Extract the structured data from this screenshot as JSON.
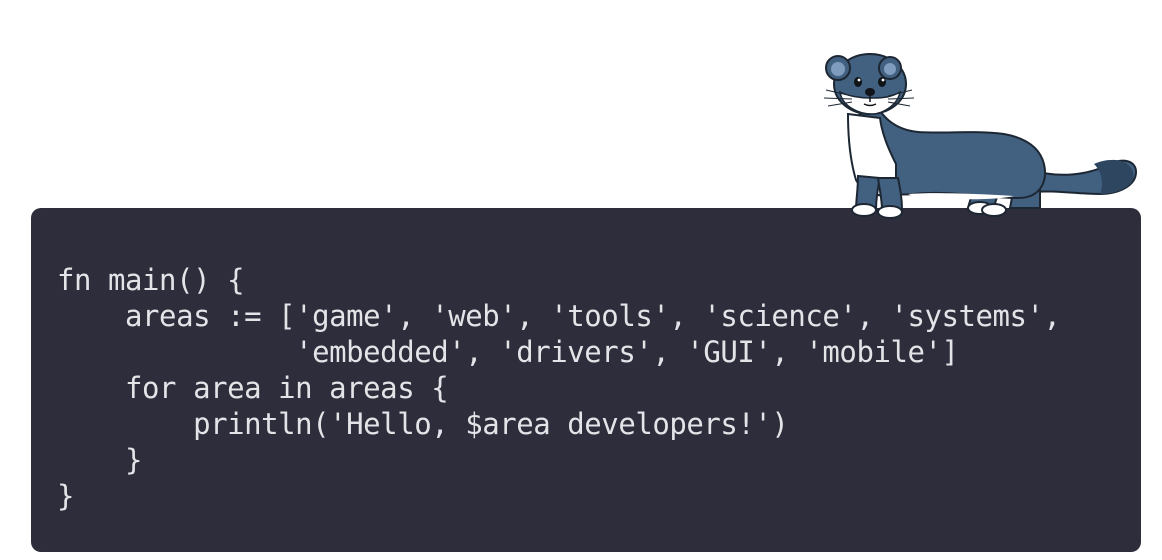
{
  "code": {
    "lines": [
      "fn main() {",
      "    areas := ['game', 'web', 'tools', 'science', 'systems',",
      "              'embedded', 'drivers', 'GUI', 'mobile']",
      "    for area in areas {",
      "        println('Hello, $area developers!')",
      "    }",
      "}"
    ]
  },
  "colors": {
    "panel_background": "#2d2d3b",
    "code_text": "#e3e3e8",
    "mascot_body": "#42607f",
    "mascot_belly": "#ffffff"
  },
  "icons": {
    "mascot": "weasel-mascot-icon"
  }
}
